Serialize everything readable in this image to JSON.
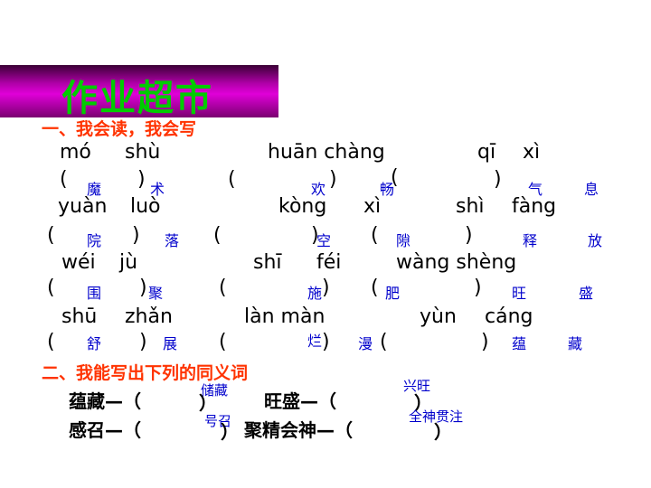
{
  "title": "作业超市",
  "section1_heading": "一、我会读，我会写",
  "pinyin": [
    "mó",
    "shù",
    "huān chàng",
    "qī",
    "xì",
    "yuàn",
    "luò",
    "kòng",
    "xì",
    "shì",
    "fàng",
    "wéi",
    "jù",
    "shī",
    "féi",
    "wàng shèng",
    "shū",
    "zhǎn",
    "làn màn",
    "yùn",
    "cáng"
  ],
  "answers": [
    "魔",
    "术",
    "欢",
    "畅",
    "气",
    "息",
    "院",
    "落",
    "空",
    "隙",
    "释",
    "放",
    "围",
    "聚",
    "施",
    "肥",
    "旺",
    "盛",
    "舒",
    "展",
    "烂",
    "漫",
    "蕴",
    "藏"
  ],
  "section2_heading": "二、我能写出下列的同义词",
  "synonyms": {
    "q1": "蕴藏—（",
    "a1": "储藏",
    "q2": "旺盛—（",
    "a2": "兴旺",
    "q3": "感召—（",
    "a3": "号召",
    "q4": "聚精会神—（",
    "a4": "全神贯注"
  }
}
